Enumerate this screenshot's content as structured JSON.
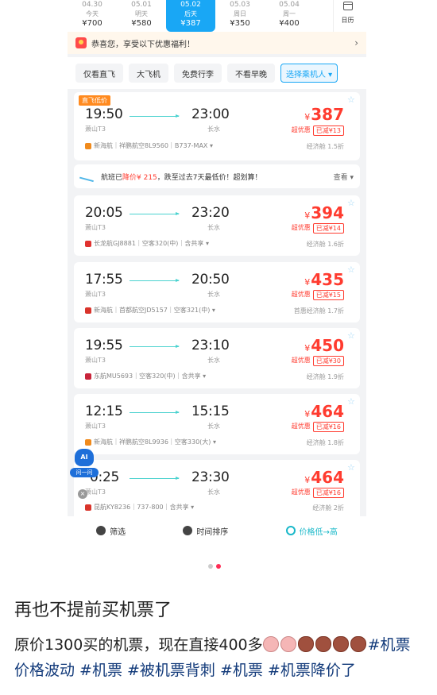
{
  "date_tabs": [
    {
      "date": "04.30",
      "weekday": "今天",
      "price": "¥700",
      "active": false
    },
    {
      "date": "05.01",
      "weekday": "明天",
      "price": "¥580",
      "active": false
    },
    {
      "date": "05.02",
      "weekday": "后天",
      "price": "¥387",
      "active": true
    },
    {
      "date": "05.03",
      "weekday": "周日",
      "price": "¥350",
      "active": false
    },
    {
      "date": "05.04",
      "weekday": "周一",
      "price": "¥400",
      "active": false
    }
  ],
  "calendar_label": "日历",
  "promo_text": "恭喜您，享受以下优惠福利！",
  "promo_arrow": "›",
  "filter_chips": [
    "仅看直飞",
    "大飞机",
    "免费行李",
    "不看早晚"
  ],
  "passenger_select": "选择乘机人 ▾",
  "notice": {
    "prefix": "航班已",
    "highlight": "降价¥ 215",
    "suffix": "，跌至过去7天最低价！超划算！",
    "more": "查看 ▾"
  },
  "flights": [
    {
      "tag": "直飞低价",
      "dep_time": "19:50",
      "arr_time": "23:00",
      "dep_airport": "萧山T3",
      "arr_airport": "长水",
      "price": "387",
      "badge1": "超优惠",
      "badge2": "已减¥13",
      "airline": "新海航｜祥鹏航空8L9560｜B737-MAX ▾",
      "cabin": "经济舱 1.5折",
      "logo_color": "#f08a1c"
    },
    {
      "tag": "",
      "dep_time": "20:05",
      "arr_time": "23:20",
      "dep_airport": "萧山T3",
      "arr_airport": "长水",
      "price": "394",
      "badge1": "超优惠",
      "badge2": "已减¥14",
      "airline": "长龙航GJ8881｜空客320(中)｜含共享 ▾",
      "cabin": "经济舱 1.6折",
      "logo_color": "#e0312f"
    },
    {
      "tag": "",
      "dep_time": "17:55",
      "arr_time": "20:50",
      "dep_airport": "萧山T3",
      "arr_airport": "长水",
      "price": "435",
      "badge1": "超优惠",
      "badge2": "已减¥15",
      "airline": "新海航｜首都航空JD5157｜空客321(中) ▾",
      "cabin": "首惠经济舱 1.7折",
      "logo_color": "#d9342b"
    },
    {
      "tag": "",
      "dep_time": "19:55",
      "arr_time": "23:10",
      "dep_airport": "萧山T3",
      "arr_airport": "长水",
      "price": "450",
      "badge1": "超优惠",
      "badge2": "已减¥30",
      "airline": "东航MU5693｜空客320(中)｜含共享 ▾",
      "cabin": "经济舱 1.9折",
      "logo_color": "#c8243a"
    },
    {
      "tag": "",
      "dep_time": "12:15",
      "arr_time": "15:15",
      "dep_airport": "萧山T3",
      "arr_airport": "长水",
      "price": "464",
      "badge1": "超优惠",
      "badge2": "已减¥16",
      "airline": "新海航｜祥鹏航空8L9936｜空客330(大) ▾",
      "cabin": "经济舱 1.8折",
      "logo_color": "#f08a1c"
    },
    {
      "tag": "",
      "dep_time": "0:25",
      "arr_time": "23:30",
      "dep_airport": "萧山T3",
      "arr_airport": "长水",
      "price": "464",
      "badge1": "超优惠",
      "badge2": "已减¥16",
      "airline": "昆航KY8236｜737-800｜含共享 ▾",
      "cabin": "经济舱 2折",
      "logo_color": "#d9342b"
    }
  ],
  "ai_assistant": {
    "icon_text": "AI",
    "label": "问一问",
    "close": "×"
  },
  "bottom_bar": {
    "filter": "筛选",
    "time_sort": "时间排序",
    "price_sort": "价格低→高"
  },
  "post": {
    "title": "再也不提前买机票了",
    "body_text": "原价1300买的机票，现在直接400多",
    "tags": "#机票价格波动 #机票 #被机票背刺 #机票 #机票降价了"
  }
}
